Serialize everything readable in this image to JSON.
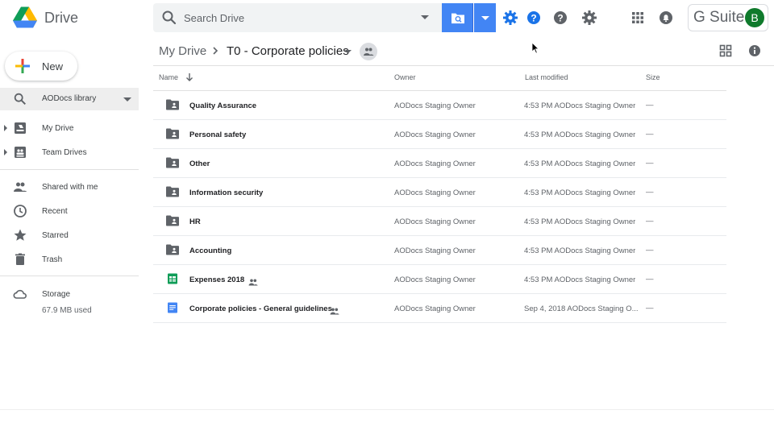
{
  "header": {
    "app_name": "Drive",
    "search_placeholder": "Search Drive",
    "gsuite_label": "G Suite",
    "avatar_letter": "B"
  },
  "sidebar": {
    "new_label": "New",
    "library_label": "AODocs library",
    "items": [
      {
        "label": "My Drive",
        "icon": "my-drive-icon"
      },
      {
        "label": "Team Drives",
        "icon": "team-drives-icon"
      },
      {
        "label": "Shared with me",
        "icon": "people-icon"
      },
      {
        "label": "Recent",
        "icon": "clock-icon"
      },
      {
        "label": "Starred",
        "icon": "star-icon"
      },
      {
        "label": "Trash",
        "icon": "trash-icon"
      },
      {
        "label": "Storage",
        "icon": "cloud-icon"
      }
    ],
    "storage_used": "67.9 MB used"
  },
  "breadcrumb": {
    "root": "My Drive",
    "current": "T0 - Corporate policies"
  },
  "columns": {
    "name": "Name",
    "owner": "Owner",
    "modified": "Last modified",
    "size": "Size"
  },
  "files": [
    {
      "name": "Quality Assurance",
      "type": "shared-folder",
      "shared": false,
      "owner": "AODocs Staging Owner",
      "modified": "4:53 PM  AODocs Staging Owner",
      "size": "—"
    },
    {
      "name": "Personal safety",
      "type": "shared-folder",
      "shared": false,
      "owner": "AODocs Staging Owner",
      "modified": "4:53 PM  AODocs Staging Owner",
      "size": "—"
    },
    {
      "name": "Other",
      "type": "shared-folder",
      "shared": false,
      "owner": "AODocs Staging Owner",
      "modified": "4:53 PM  AODocs Staging Owner",
      "size": "—"
    },
    {
      "name": "Information security",
      "type": "shared-folder",
      "shared": false,
      "owner": "AODocs Staging Owner",
      "modified": "4:53 PM  AODocs Staging Owner",
      "size": "—"
    },
    {
      "name": "HR",
      "type": "shared-folder",
      "shared": false,
      "owner": "AODocs Staging Owner",
      "modified": "4:53 PM  AODocs Staging Owner",
      "size": "—"
    },
    {
      "name": "Accounting",
      "type": "shared-folder",
      "shared": false,
      "owner": "AODocs Staging Owner",
      "modified": "4:53 PM  AODocs Staging Owner",
      "size": "—"
    },
    {
      "name": "Expenses 2018",
      "type": "sheets",
      "shared": true,
      "owner": "AODocs Staging Owner",
      "modified": "4:53 PM  AODocs Staging Owner",
      "size": "—"
    },
    {
      "name": "Corporate policies - General guidelines",
      "type": "docs",
      "shared": true,
      "owner": "AODocs Staging Owner",
      "modified": "Sep 4, 2018  AODocs Staging O...",
      "size": "—"
    }
  ],
  "colors": {
    "accent": "#4285f4",
    "sheets": "#0f9d58",
    "docs": "#4285f4",
    "icon_gray": "#5f6368",
    "avatar": "#0f7a2c"
  }
}
